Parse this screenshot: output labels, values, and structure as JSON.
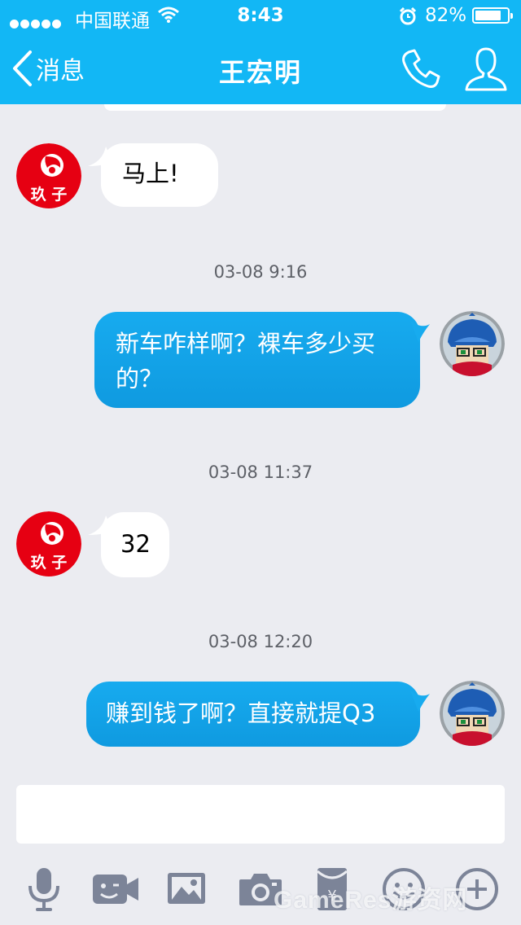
{
  "status_bar": {
    "carrier": "中国联通",
    "time": "8:43",
    "battery_percent": "82%",
    "battery_level": 0.82
  },
  "nav": {
    "back_label": "消息",
    "title": "王宏明",
    "icons": [
      "back-chevron-icon",
      "phone-icon",
      "profile-icon"
    ]
  },
  "contact_avatar_text": "玖 子",
  "messages": [
    {
      "type": "incoming",
      "text": "马上!"
    },
    {
      "type": "timestamp",
      "text": "03-08 9:16"
    },
    {
      "type": "outgoing",
      "lines": [
        "新车咋样啊？裸车多少买",
        "的？"
      ]
    },
    {
      "type": "timestamp",
      "text": "03-08 11:37"
    },
    {
      "type": "incoming",
      "text": "32"
    },
    {
      "type": "timestamp",
      "text": "03-08 12:20"
    },
    {
      "type": "outgoing",
      "text": "赚到钱了啊？直接就提Q3"
    }
  ],
  "input": {
    "value": "",
    "placeholder": ""
  },
  "toolbar": [
    "microphone-icon",
    "video-call-icon",
    "image-icon",
    "camera-icon",
    "red-packet-icon",
    "emoji-icon",
    "plus-icon"
  ],
  "watermark": "GameRes游资网",
  "colors": {
    "header": "#12b7f5",
    "outgoing_bubble": "#12a1e8",
    "incoming_bubble": "#ffffff",
    "background": "#ebecf1",
    "toolbar_icons": "#7c8498",
    "avatar_red": "#e60012"
  }
}
